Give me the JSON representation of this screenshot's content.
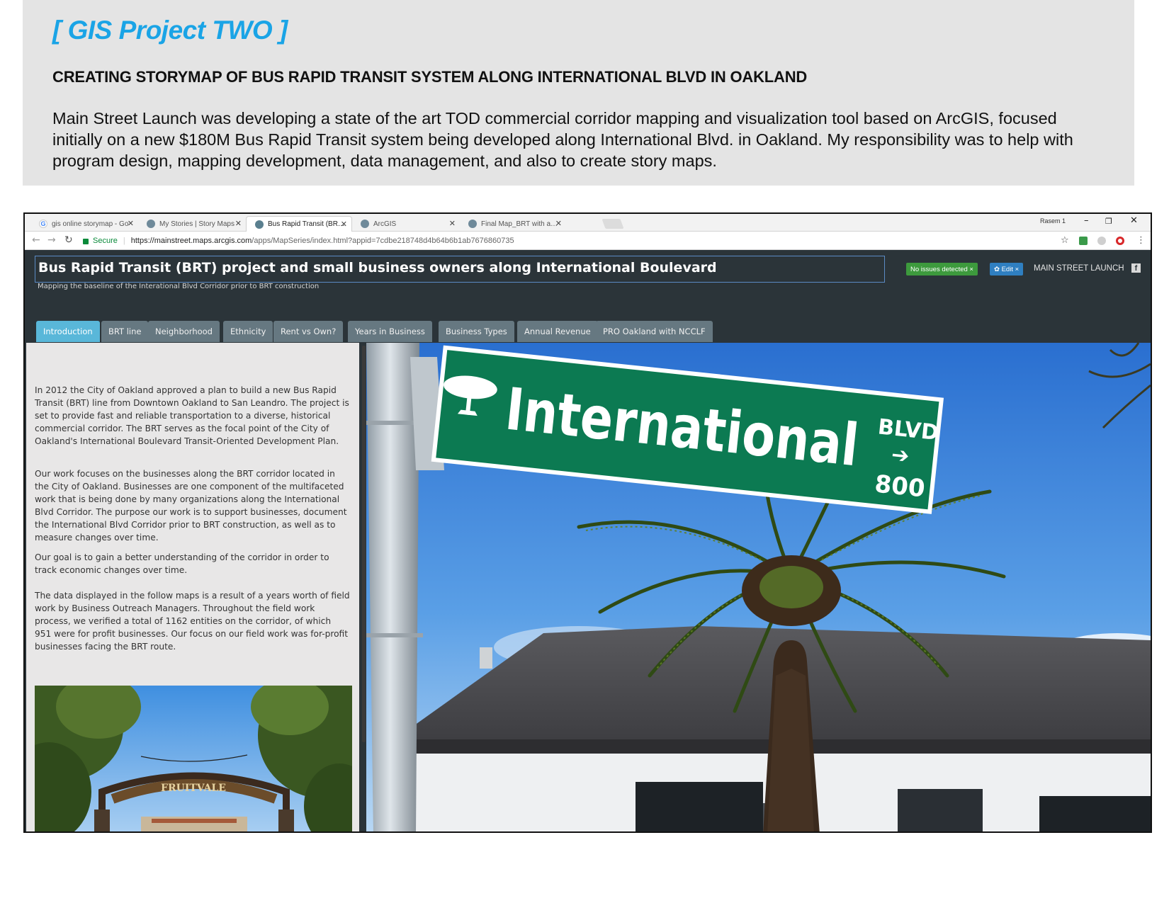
{
  "portfolio": {
    "title": "[ GIS Project TWO ]",
    "subtitle": "CREATING STORYMAP OF BUS RAPID TRANSIT SYSTEM ALONG INTERNATIONAL BLVD IN OAKLAND",
    "description": "Main Street Launch  was developing a state of the art TOD commercial corridor mapping and visualization tool based on ArcGIS, focused initially on a new $180M Bus Rapid Transit system being developed along International Blvd. in Oakland. My responsibility was to help with program design, mapping development, data management, and also to create story maps."
  },
  "browser": {
    "tabs": [
      {
        "label": "gis online storymap - Go",
        "icon": "google-icon",
        "active": false
      },
      {
        "label": "My Stories | Story Maps",
        "icon": "globe-icon",
        "active": false
      },
      {
        "label": "Bus Rapid Transit (BRT) p",
        "icon": "globe-icon",
        "active": true
      },
      {
        "label": "ArcGIS",
        "icon": "globe-icon",
        "active": false
      },
      {
        "label": "Final Map_BRT with all la",
        "icon": "globe-icon",
        "active": false
      }
    ],
    "user": "Rasem 1",
    "secure_label": "Secure",
    "url_host": "https://mainstreet.maps.arcgis.com",
    "url_path": "/apps/MapSeries/index.html?appid=7cdbe218748d4b64b6b1ab7676860735"
  },
  "app": {
    "title": "Bus Rapid Transit (BRT) project and small business owners along International Boulevard",
    "subtitle": "Mapping the baseline of the Interational Blvd Corridor prior to BRT construction",
    "status_badge": "No issues detected ×",
    "edit_badge": "✿ Edit ×",
    "brand": "MAIN STREET LAUNCH",
    "accent_color": "#59b7d9",
    "header_color": "#2b3439"
  },
  "story_tabs": [
    {
      "label": "Introduction",
      "active": true
    },
    {
      "label": "BRT line",
      "active": false
    },
    {
      "label": "Neighborhood",
      "active": false
    },
    {
      "label": "Ethnicity",
      "active": false
    },
    {
      "label": "Rent vs Own?",
      "active": false
    },
    {
      "label": "Years in Business",
      "active": false
    },
    {
      "label": "Business Types",
      "active": false
    },
    {
      "label": "Annual Revenue",
      "active": false
    },
    {
      "label": "PRO Oakland with NCCLF",
      "active": false
    }
  ],
  "side_panel": {
    "paragraphs": [
      "In 2012 the City of Oakland approved a plan to build a new Bus Rapid Transit (BRT) line from Downtown Oakland to San Leandro. The project is set to provide fast and reliable transportation to a diverse, historical commercial corridor. The BRT serves as the focal point of the City of Oakland's International Boulevard Transit-Oriented Development Plan.",
      "Our work focuses on the businesses along the BRT corridor located in the City of Oakland. Businesses are one component of the multifaceted work that is being done by many organizations along the International Blvd Corridor. The purpose our work is to support businesses, document the International Blvd Corridor prior to BRT construction, as well as to measure changes over time.",
      "Our goal is to gain a better understanding of the corridor in order to track economic changes over time.",
      "The data displayed in the follow maps is a result of a years worth of field work by Business Outreach Managers. Throughout the field work process, we verified a total of 1162 entities on the corridor, of which 951 were for profit businesses. Our focus on our field work was for-profit businesses facing the BRT route."
    ],
    "photo_sign_text": "FRUITVALE"
  },
  "street_sign": {
    "name": "International",
    "suffix": "BLVD",
    "number": "800"
  }
}
